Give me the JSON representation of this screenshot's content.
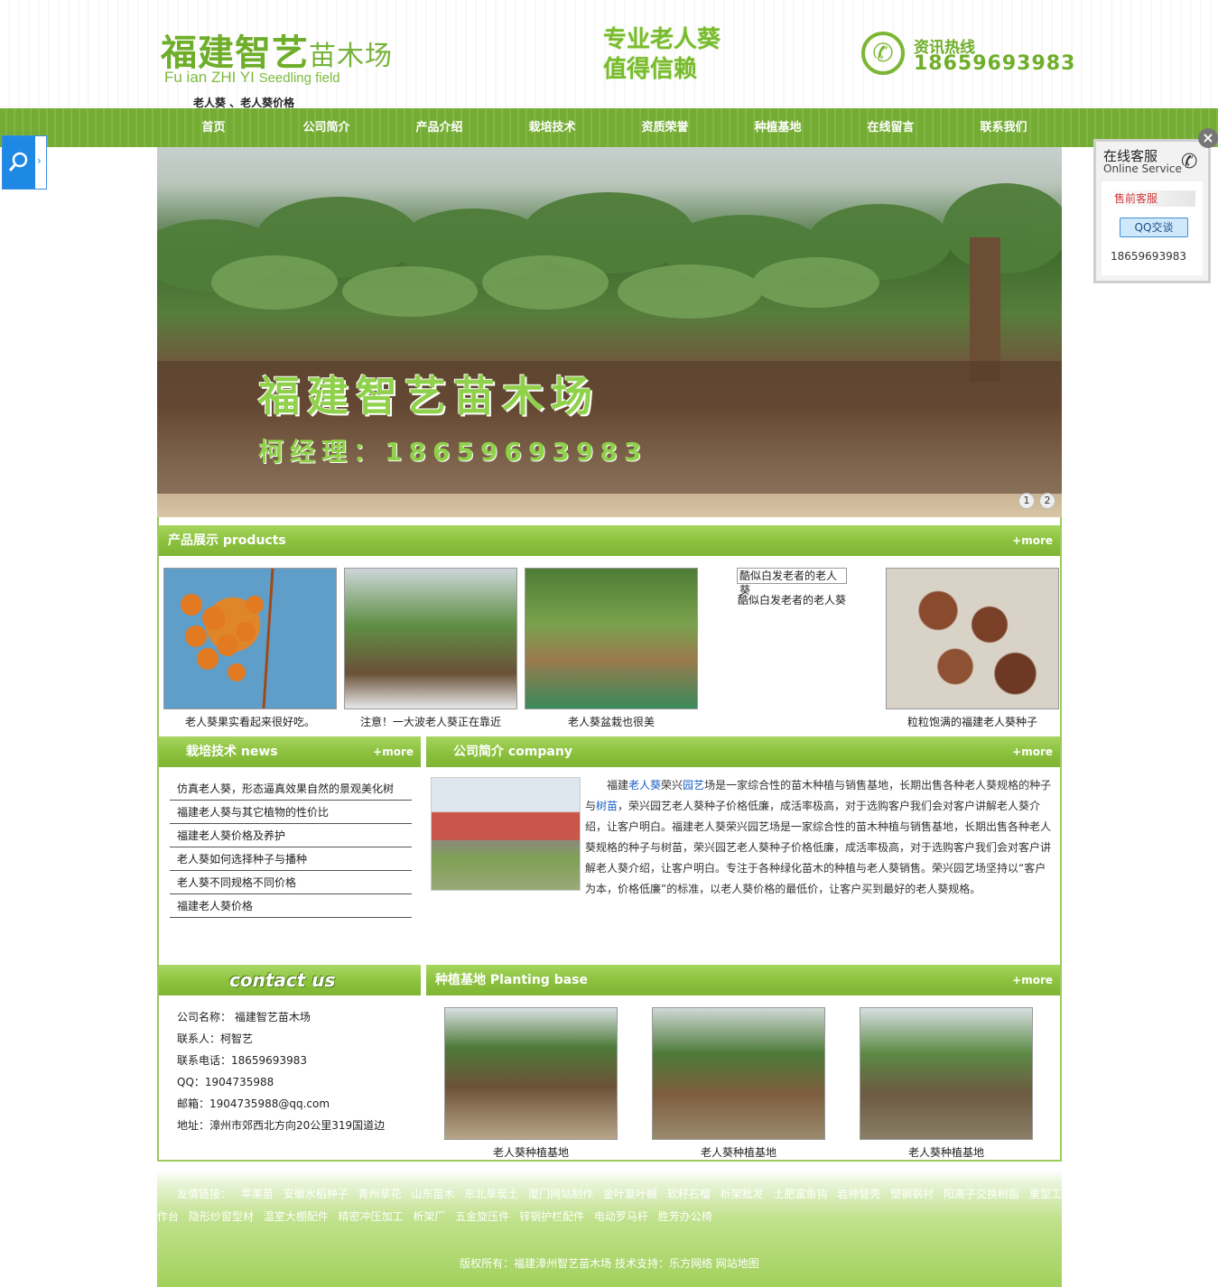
{
  "header": {
    "logo_cn": "福建智艺",
    "logo_cn_light": "苗木场",
    "logo_en": "Fu ian ZHI YI",
    "logo_en_small": "Seedling field",
    "keywords": "老人葵 、老人葵价格",
    "slogan_line1": "专业老人葵",
    "slogan_line2": "值得信赖",
    "hotline_label": "资讯热线",
    "hotline_number": "18659693983"
  },
  "nav": [
    "首页",
    "公司简介",
    "产品介绍",
    "栽培技术",
    "资质荣誉",
    "种植基地",
    "在线留言",
    "联系我们"
  ],
  "banner": {
    "title": "福建智艺苗木场",
    "phone": "柯经理：18659693983",
    "dots": [
      "1",
      "2"
    ]
  },
  "products": {
    "heading": "产品展示 products",
    "more": "+more",
    "items": [
      {
        "caption": "老人葵果实看起来很好吃。"
      },
      {
        "caption": "注意！一大波老人葵正在靠近"
      },
      {
        "caption": "老人葵盆栽也很美"
      },
      {
        "caption": "酷似白发老者的老人葵"
      },
      {
        "caption": "粒粒饱满的福建老人葵种子"
      }
    ],
    "broken_img_alt": "酷似白发老者的老人葵"
  },
  "news": {
    "heading": "栽培技术 news",
    "more": "+more",
    "items": [
      "仿真老人葵，形态逼真效果自然的景观美化树",
      "福建老人葵与其它植物的性价比",
      "福建老人葵价格及养护",
      "老人葵如何选择种子与播种",
      "老人葵不同规格不同价格",
      "福建老人葵价格"
    ]
  },
  "company": {
    "heading": "公司简介 company",
    "more": "+more",
    "t1": "福建",
    "link1": "老人葵",
    "t2": "荣兴",
    "link2": "园艺",
    "t3": "场是一家综合性的苗木种植与销售基地，长期出售各种老人葵规格的种子与",
    "link3": "树苗",
    "t4": "，荣兴园艺老人葵种子价格低廉，成活率极高，对于选购客户我们会对客户讲解老人葵介绍，让客户明白。福建老人葵荣兴园艺场是一家综合性的苗木种植与销售基地，长期出售各种老人葵规格的种子与树苗，荣兴园艺老人葵种子价格低廉，成活率极高，对于选购客户我们会对客户讲解老人葵介绍，让客户明白。专注于各种绿化苗木的种植与老人葵销售。荣兴园艺场坚持以“客户为本，价格低廉”的标准，以老人葵价格的最低价，让客户买到最好的老人葵规格。"
  },
  "contact": {
    "heading": "contact us",
    "lines": [
      "公司名称： 福建智艺苗木场",
      "联系人：柯智艺",
      "联系电话：18659693983",
      "QQ：1904735988",
      "邮箱：1904735988@qq.com",
      "地址：漳州市郊西北方向20公里319国道边"
    ]
  },
  "base": {
    "heading": "种植基地 Planting base",
    "more": "+more",
    "items": [
      "老人葵种植基地",
      "老人葵种植基地",
      "老人葵种植基地"
    ]
  },
  "footer": {
    "links_label": "友情链接：",
    "links": [
      "苹果苗",
      "安徽水稻种子",
      "青州草花",
      "山东苗木",
      "东北草炭土",
      "厦门网站制作",
      "金叶复叶槭",
      "软籽石榴",
      "析架批发",
      "土肥富鱼钩",
      "岩棉管壳",
      "塑钢钢衬",
      "阳离子交换树脂",
      "重型工作台",
      "隐形纱窗型材",
      "温室大棚配件",
      "精密冲压加工",
      "析架厂",
      "五金旋压件",
      "锌钢护栏配件",
      "电动罗马杆",
      "胜芳办公椅"
    ],
    "copyright": "版权所有：福建漳州智艺苗木场 技术支持：乐方网络 网站地图"
  },
  "service": {
    "title": "在线客服",
    "subtitle": "Online Service",
    "presale": "售前客服",
    "qq_button": "QQ交谈",
    "phone": "18659693983",
    "close": "×"
  },
  "search": {
    "icon": "search-icon",
    "arrow": "›"
  },
  "colors": {
    "brand_green": "#7fb434",
    "link_blue": "#1a5fc7",
    "nav_green": "#75ac35"
  }
}
